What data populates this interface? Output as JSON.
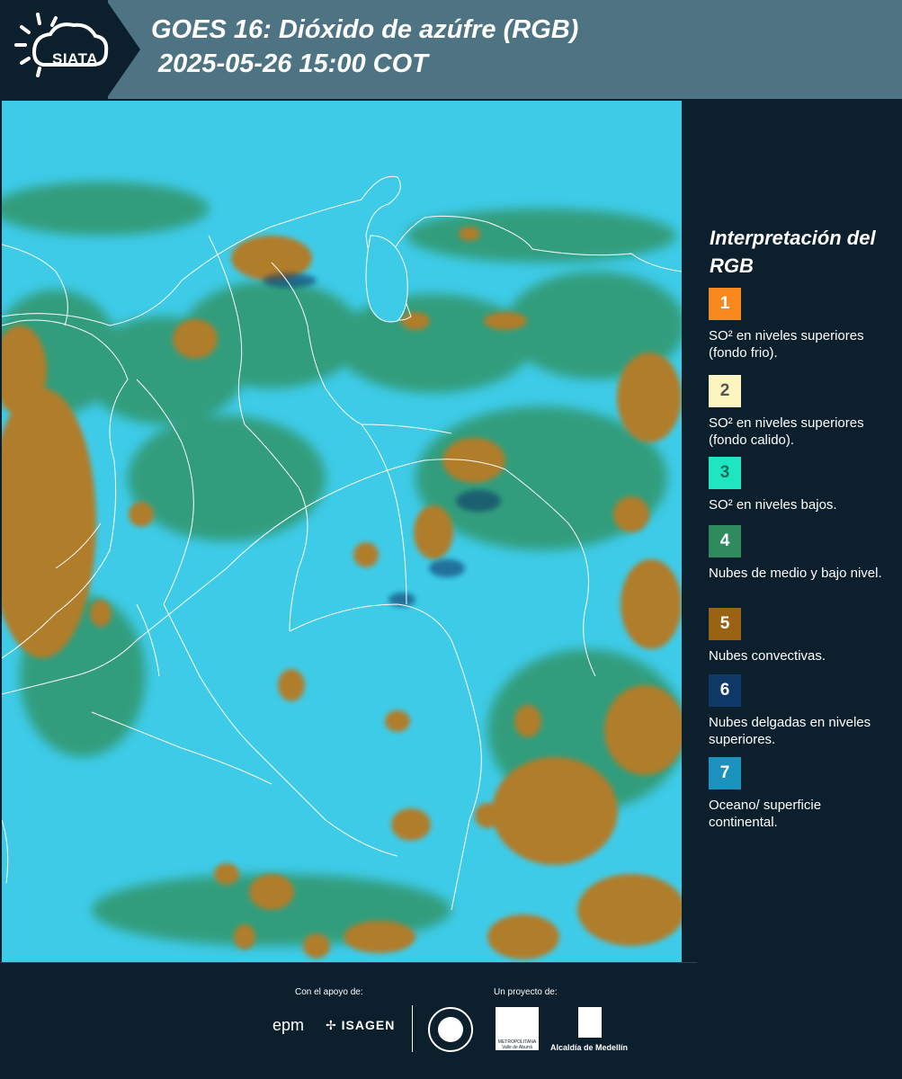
{
  "header": {
    "logo_text": "SIATA",
    "title_line1": "GOES 16: Dióxido de azúfre (RGB)",
    "title_line2": "2025-05-26 15:00 COT"
  },
  "legend": {
    "title": "Interpretación del RGB",
    "items": [
      {
        "number": "1",
        "color": "#f7891f",
        "text_color": "#ffffff",
        "label": "SO² en niveles superiores (fondo frio)."
      },
      {
        "number": "2",
        "color": "#fdf5c0",
        "text_color": "#555555",
        "label": "SO² en niveles superiores (fondo calido)."
      },
      {
        "number": "3",
        "color": "#1fe6c0",
        "text_color": "#1a6e62",
        "label": "SO² en niveles bajos."
      },
      {
        "number": "4",
        "color": "#2f8a5e",
        "text_color": "#ffffff",
        "label": "Nubes de medio y bajo nivel."
      },
      {
        "number": "5",
        "color": "#9a6314",
        "text_color": "#ffffff",
        "label": "Nubes convectivas."
      },
      {
        "number": "6",
        "color": "#0d3868",
        "text_color": "#ffffff",
        "label": "Nubes delgadas en niveles superiores."
      },
      {
        "number": "7",
        "color": "#1b92bd",
        "text_color": "#ffffff",
        "label": "Oceano/ superficie continental."
      }
    ]
  },
  "footer": {
    "support_label": "Con el apoyo de:",
    "project_label": "Un proyecto de:",
    "epm": "epm",
    "isagen": "ISAGEN",
    "area_text": "METROPOLITANA Valle de Aburrá",
    "alcaldia": "Alcaldía de Medellín"
  },
  "map": {
    "ocean_color": "#3ecbe8",
    "cloud_color": "#b07d2a",
    "green_color": "#2f8e58",
    "border_color": "#ffffff"
  }
}
